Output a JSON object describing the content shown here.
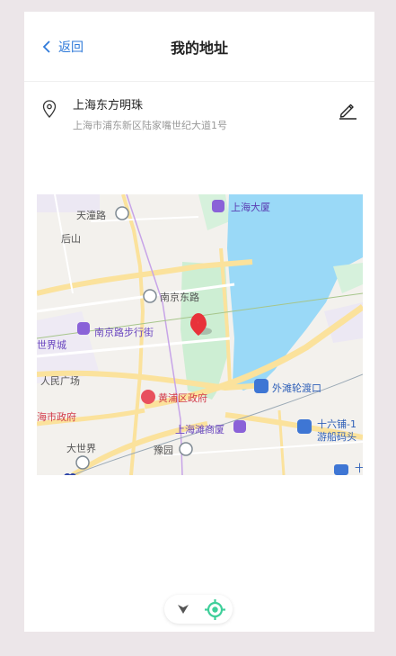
{
  "header": {
    "back_label": "返回",
    "title": "我的地址"
  },
  "address": {
    "name": "上海东方明珠",
    "detail": "上海市浦东新区陆家嘴世纪大道1号"
  },
  "map": {
    "labels": {
      "tiantong_road": "天潼路",
      "houshan": "后山",
      "shanghai_mansion": "上海大厦",
      "east_nanjing_road": "南京东路",
      "nanjing_pedestrian_street": "南京路步行街",
      "world_city": "世界城",
      "peoples_square": "人民广场",
      "huangpu_gov": "黄浦区政府",
      "bund_ferry": "外滩轮渡口",
      "city_gov": "海市政府",
      "shanghai_tan_mall": "上海滩商厦",
      "shiliupu": "十六铺-1",
      "cruise_terminal": "游船码头",
      "da_shi_jie": "大世界",
      "yuyuan": "豫园",
      "shi": "十"
    }
  },
  "colors": {
    "accent": "#2f7ad9",
    "marker": "#e8323a",
    "river": "#9ad9f7",
    "locate": "#3ecf9a"
  }
}
